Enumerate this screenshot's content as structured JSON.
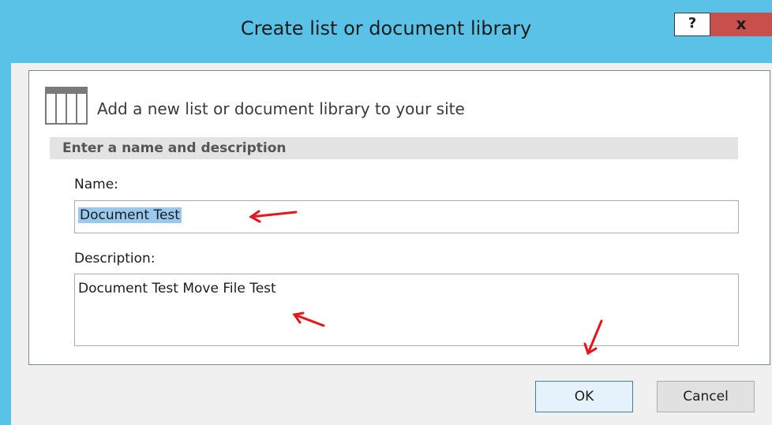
{
  "window": {
    "title": "Create list or document library",
    "help_label": "?",
    "close_label": "x"
  },
  "panel": {
    "heading": "Add a new list or document library to your site",
    "section_label": "Enter a name and description",
    "name_label": "Name:",
    "name_value": "Document Test",
    "description_label": "Description:",
    "description_value": "Document Test Move File Test"
  },
  "buttons": {
    "ok_label": "OK",
    "cancel_label": "Cancel"
  },
  "colors": {
    "titlebar": "#5bc2e7",
    "close": "#c7504c",
    "annotation_arrows": "#e8141c",
    "selection": "#99c9ef"
  }
}
